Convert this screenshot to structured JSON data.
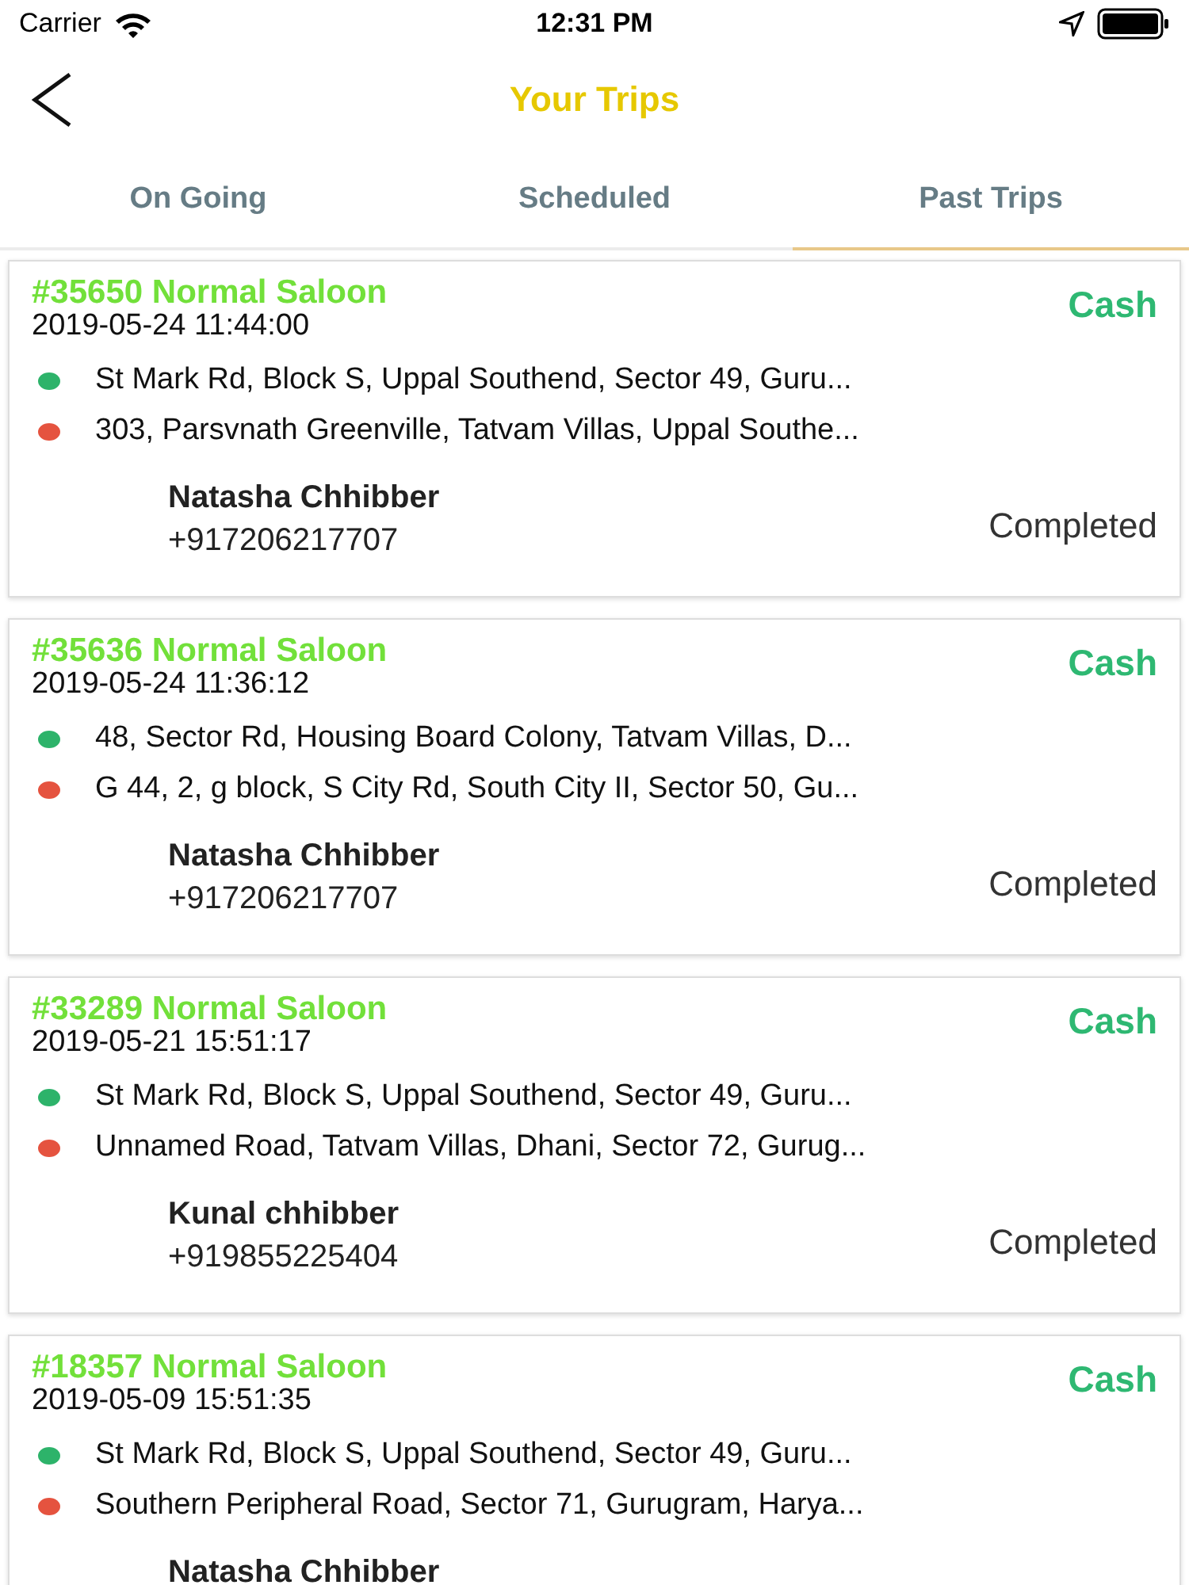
{
  "status_bar": {
    "carrier": "Carrier",
    "time": "12:31 PM"
  },
  "nav": {
    "title": "Your Trips"
  },
  "tabs": [
    {
      "label": "On Going",
      "selected": false
    },
    {
      "label": "Scheduled",
      "selected": false
    },
    {
      "label": "Past Trips",
      "selected": true
    }
  ],
  "trips": [
    {
      "title": "#35650 Normal Saloon",
      "payment": "Cash",
      "datetime": "2019-05-24 11:44:00",
      "stops": [
        {
          "address": "St Mark Rd, Block S, Uppal Southend, Sector 49, Guru...",
          "color": "#2db36a"
        },
        {
          "address": "303, Parsvnath Greenville, Tatvam Villas, Uppal Southe...",
          "color": "#e5533f"
        }
      ],
      "name": "Natasha Chhibber",
      "phone": "+917206217707",
      "status": "Completed"
    },
    {
      "title": "#35636 Normal Saloon",
      "payment": "Cash",
      "datetime": "2019-05-24 11:36:12",
      "stops": [
        {
          "address": "48, Sector Rd, Housing Board Colony, Tatvam Villas, D...",
          "color": "#2db36a"
        },
        {
          "address": "G 44, 2, g block, S City Rd, South City II, Sector 50, Gu...",
          "color": "#e5533f"
        }
      ],
      "name": "Natasha Chhibber",
      "phone": "+917206217707",
      "status": "Completed"
    },
    {
      "title": "#33289 Normal Saloon",
      "payment": "Cash",
      "datetime": "2019-05-21 15:51:17",
      "stops": [
        {
          "address": "St Mark Rd, Block S, Uppal Southend, Sector 49, Guru...",
          "color": "#2db36a"
        },
        {
          "address": "Unnamed Road, Tatvam Villas, Dhani, Sector 72, Gurug...",
          "color": "#e5533f"
        }
      ],
      "name": "Kunal chhibber",
      "phone": "+919855225404",
      "status": "Completed"
    },
    {
      "title": "#18357 Normal Saloon",
      "payment": "Cash",
      "datetime": "2019-05-09 15:51:35",
      "stops": [
        {
          "address": "St Mark Rd, Block S, Uppal Southend, Sector 49, Guru...",
          "color": "#2db36a"
        },
        {
          "address": "Southern Peripheral Road, Sector 71, Gurugram, Harya...",
          "color": "#e5533f"
        }
      ],
      "name": "Natasha Chhibber"
    }
  ]
}
